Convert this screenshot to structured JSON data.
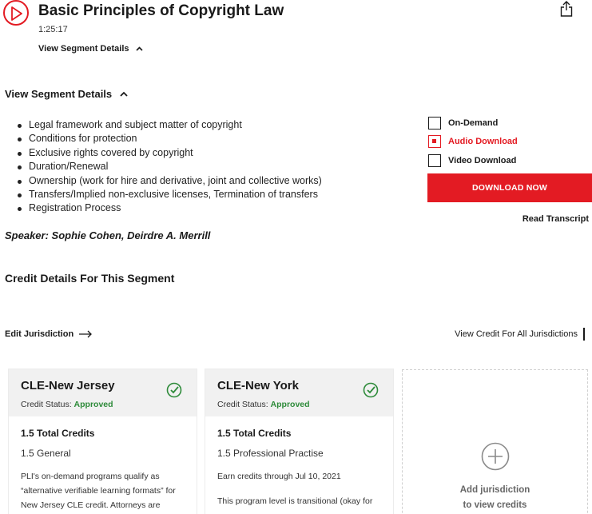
{
  "header": {
    "title": "Basic Principles of Copyright Law",
    "duration": "1:25:17",
    "segment_toggle_label": "View Segment Details"
  },
  "segment": {
    "toggle_label": "View Segment Details",
    "topics": [
      "Legal framework and subject matter of copyright",
      "Conditions for protection",
      "Exclusive rights covered by copyright",
      "Duration/Renewal",
      "Ownership (work for hire and derivative, joint and collective works)",
      "Transfers/Implied non-exclusive licenses, Termination of transfers",
      "Registration Process"
    ],
    "speaker": "Speaker: Sophie Cohen, Deirdre A. Merrill"
  },
  "formats": {
    "options": [
      {
        "label": "On-Demand",
        "checked": false
      },
      {
        "label": "Audio Download",
        "checked": true
      },
      {
        "label": "Video Download",
        "checked": false
      }
    ],
    "download_label": "DOWNLOAD NOW",
    "transcript_label": "Read Transcript"
  },
  "credits": {
    "heading": "Credit Details For This Segment",
    "edit_jurisdiction_label": "Edit Jurisdiction",
    "view_all_label": "View Credit For All Jurisdictions",
    "cards": [
      {
        "title": "CLE-New Jersey",
        "status_label": "Credit Status:",
        "status_value": "Approved",
        "total": "1.5 Total Credits",
        "type": "1.5 General",
        "note": "PLI's on-demand programs qualify as “alternative verifiable learning formats” for New Jersey CLE credit. Attorneys are limited"
      },
      {
        "title": "CLE-New York",
        "status_label": "Credit Status:",
        "status_value": "Approved",
        "total": "1.5 Total Credits",
        "type": "1.5 Professional Practise",
        "earn_through": "Earn credits through Jul 10, 2021",
        "note": "This program level is transitional (okay for"
      }
    ],
    "add_card": {
      "line1": "Add jurisdiction",
      "line2": "to view credits"
    }
  },
  "colors": {
    "accent": "#e31b23",
    "approved": "#2e8b3a",
    "card_header_bg": "#f1f1f1"
  },
  "icons": {
    "play": "play-circle-icon",
    "share": "share-icon",
    "chevron": "chevron-up-icon",
    "arrow": "arrow-right-icon",
    "check": "check-circle-icon",
    "plus": "plus-circle-icon"
  }
}
